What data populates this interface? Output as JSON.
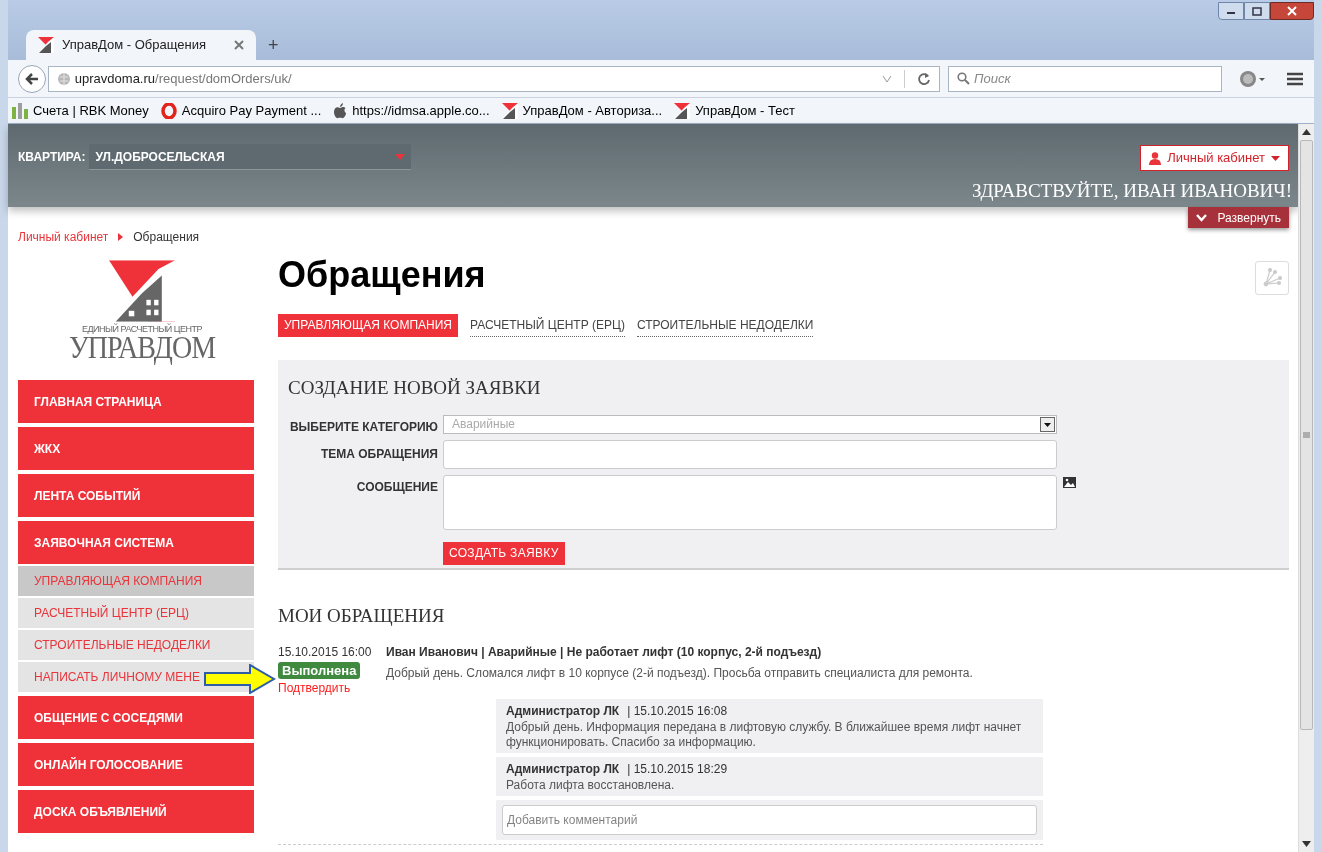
{
  "browser": {
    "tab_title": "УправДом - Обращения",
    "new_tab": "+",
    "url_host": "upravdoma.ru",
    "url_path": "/request/domOrders/uk/",
    "search_placeholder": "Поиск",
    "bookmarks": [
      {
        "label": "Счета | RBK Money",
        "kind": "bars"
      },
      {
        "label": "Acquiro Pay Payment ...",
        "kind": "ring"
      },
      {
        "label": "https://idmsa.apple.co...",
        "kind": "apple"
      },
      {
        "label": "УправДом - Авториза...",
        "kind": "house"
      },
      {
        "label": "УправДом - Тест",
        "kind": "house"
      }
    ]
  },
  "header": {
    "apartment_label": "КВАРТИРА:",
    "apartment_value": "УЛ.ДОБРОСЕЛЬСКАЯ",
    "account_button": "Личный кабинет",
    "greeting": "ЗДРАВСТВУЙТЕ, ИВАН ИВАНОВИЧ!",
    "expand_button": "Развернуть"
  },
  "breadcrumb": [
    {
      "label": "Личный кабинет",
      "link": true
    },
    {
      "label": "Обращения",
      "link": false
    }
  ],
  "logo": {
    "subtitle": "ЕДИНЫЙ РАСЧЕТНЫЙ ЦЕНТР",
    "name": "УПРАВДОМ"
  },
  "sidebar": {
    "items": [
      {
        "label": "ГЛАВНАЯ СТРАНИЦА",
        "kind": "main",
        "selected": false
      },
      {
        "label": "ЖКХ",
        "kind": "main",
        "selected": false
      },
      {
        "label": "ЛЕНТА СОБЫТИЙ",
        "kind": "main",
        "selected": false
      },
      {
        "label": "ЗАЯВОЧНАЯ СИСТЕМА",
        "kind": "main",
        "selected": false
      },
      {
        "label": "УПРАВЛЯЮЩАЯ КОМПАНИЯ",
        "kind": "sub",
        "selected": true
      },
      {
        "label": "РАСЧЕТНЫЙ ЦЕНТР (ЕРЦ)",
        "kind": "sub",
        "selected": false
      },
      {
        "label": "СТРОИТЕЛЬНЫЕ НЕДОДЕЛКИ",
        "kind": "sub",
        "selected": false
      },
      {
        "label": "НАПИСАТЬ ЛИЧНОМУ МЕНЕ",
        "kind": "sub",
        "selected": false
      },
      {
        "label": "ОБЩЕНИЕ С СОСЕДЯМИ",
        "kind": "main",
        "selected": false
      },
      {
        "label": "ОНЛАЙН ГОЛОСОВАНИЕ",
        "kind": "main",
        "selected": false
      },
      {
        "label": "ДОСКА ОБЪЯВЛЕНИЙ",
        "kind": "main",
        "selected": false
      }
    ]
  },
  "page_title": "Обращения",
  "tabs": [
    {
      "label": "УПРАВЛЯЮЩАЯ КОМПАНИЯ",
      "selected": true
    },
    {
      "label": "РАСЧЕТНЫЙ ЦЕНТР (ЕРЦ)",
      "selected": false
    },
    {
      "label": "СТРОИТЕЛЬНЫЕ НЕДОДЕЛКИ",
      "selected": false
    }
  ],
  "new_request": {
    "title": "СОЗДАНИЕ НОВОЙ ЗАЯВКИ",
    "fields": [
      {
        "label": "ВЫБЕРИТЕ КАТЕГОРИЮ",
        "kind": "select",
        "placeholder": "Аварийные"
      },
      {
        "label": "ТЕМА ОБРАЩЕНИЯ",
        "kind": "input"
      },
      {
        "label": "СООБЩЕНИЕ",
        "kind": "textarea"
      }
    ],
    "submit": "СОЗДАТЬ ЗАЯВКУ"
  },
  "my_requests": {
    "title": "МОИ ОБРАЩЕНИЯ",
    "items": [
      {
        "date": "15.10.2015 16:00",
        "status": "Выполнена",
        "confirm": "Подтвердить",
        "title": "Иван Иванович | Аварийные | Не работает лифт (10 корпус, 2-й подъезд)",
        "text": "Добрый день. Сломался лифт в 10 корпусе (2-й подъезд). Просьба отправить специалиста для ремонта.",
        "comments": [
          {
            "author": "Администратор ЛК",
            "time": "| 15.10.2015 16:08",
            "text": "Добрый день. Информация передана в лифтовую службу. В ближайшее время лифт начнет функционировать. Спасибо за информацию."
          },
          {
            "author": "Администратор ЛК",
            "time": "| 15.10.2015 18:29",
            "text": "Работа лифта восстановлена."
          }
        ],
        "comment_placeholder": "Добавить комментарий"
      }
    ]
  }
}
